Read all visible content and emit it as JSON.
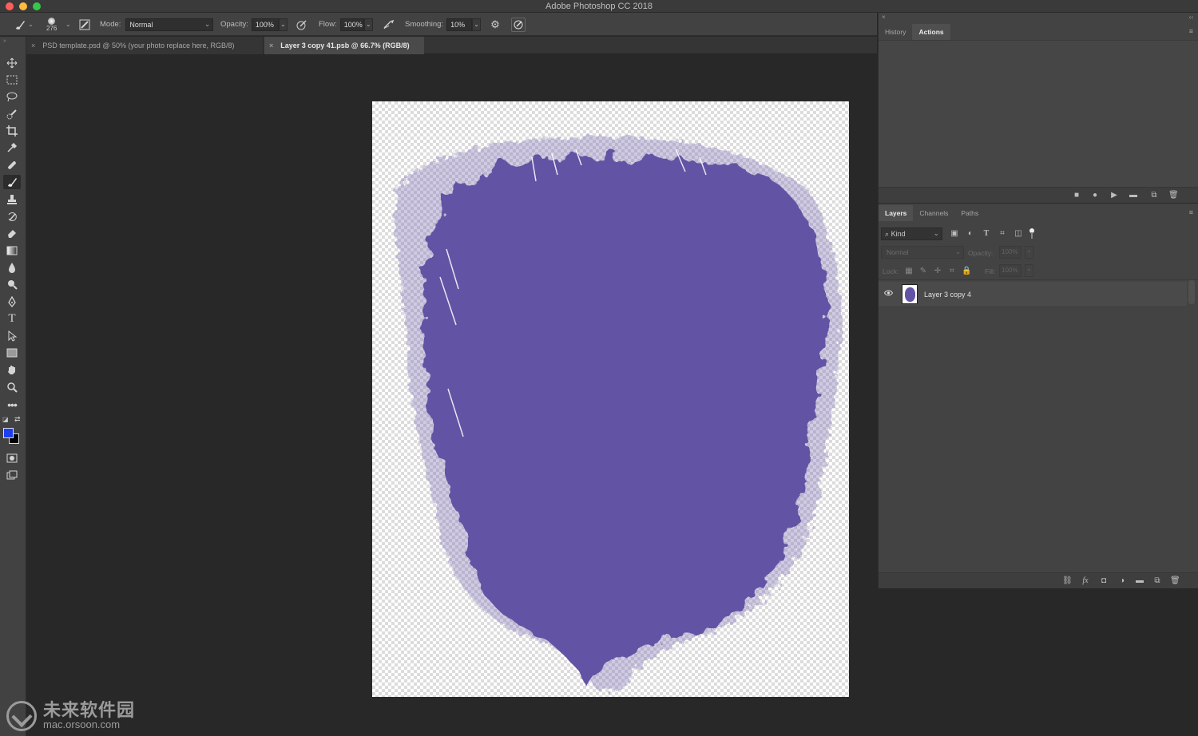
{
  "window": {
    "title": "Adobe Photoshop CC 2018"
  },
  "options_bar": {
    "brush_size": "276",
    "mode_label": "Mode:",
    "mode_value": "Normal",
    "opacity_label": "Opacity:",
    "opacity_value": "100%",
    "flow_label": "Flow:",
    "flow_value": "100%",
    "smoothing_label": "Smoothing:",
    "smoothing_value": "10%"
  },
  "doc_tabs": [
    {
      "label": "PSD template.psd @ 50% (your photo replace here, RGB/8)",
      "active": false
    },
    {
      "label": "Layer 3 copy 41.psb @ 66.7% (RGB/8)",
      "active": true
    }
  ],
  "tools": [
    "move-icon",
    "marquee-icon",
    "lasso-icon",
    "quick-select-icon",
    "crop-icon",
    "eyedropper-icon",
    "healing-icon",
    "brush-icon",
    "stamp-icon",
    "history-brush-icon",
    "eraser-icon",
    "gradient-icon",
    "blur-icon",
    "dodge-icon",
    "pen-icon",
    "type-icon",
    "path-select-icon",
    "shape-icon",
    "hand-icon",
    "zoom-icon",
    "more-icon"
  ],
  "colors": {
    "foreground": "#1e3ef0",
    "background": "#000000",
    "blob": "#6453a4"
  },
  "history_panel": {
    "tabs": [
      {
        "label": "History",
        "active": false
      },
      {
        "label": "Actions",
        "active": true
      }
    ]
  },
  "layers_panel": {
    "tabs": [
      {
        "label": "Layers",
        "active": true
      },
      {
        "label": "Channels",
        "active": false
      },
      {
        "label": "Paths",
        "active": false
      }
    ],
    "filter_label": "Kind",
    "blend_mode": "Normal",
    "opacity_label": "Opacity:",
    "opacity_value": "100%",
    "lock_label": "Lock:",
    "fill_label": "Fill:",
    "fill_value": "100%",
    "layers": [
      {
        "name": "Layer 3 copy 4",
        "visible": true
      }
    ]
  },
  "watermark": {
    "name": "未来软件园",
    "url": "mac.orsoon.com"
  }
}
